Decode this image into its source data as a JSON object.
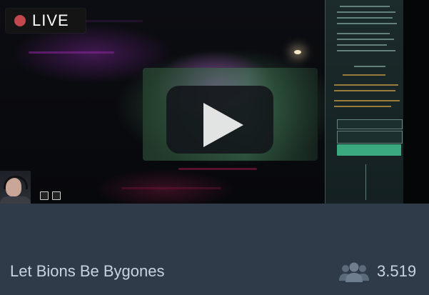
{
  "badge": {
    "live_label": "LIVE",
    "dot_color": "#c2474f"
  },
  "stream": {
    "title": "Let Bions Be Bygones",
    "viewer_count": "3.519"
  },
  "icons": {
    "live_indicator": "red-dot-icon",
    "play": "play-icon",
    "viewers": "users-icon"
  },
  "colors": {
    "info_background": "#2f3b48",
    "text": "#c7d3df",
    "panel_accent": "#3aa97f"
  }
}
